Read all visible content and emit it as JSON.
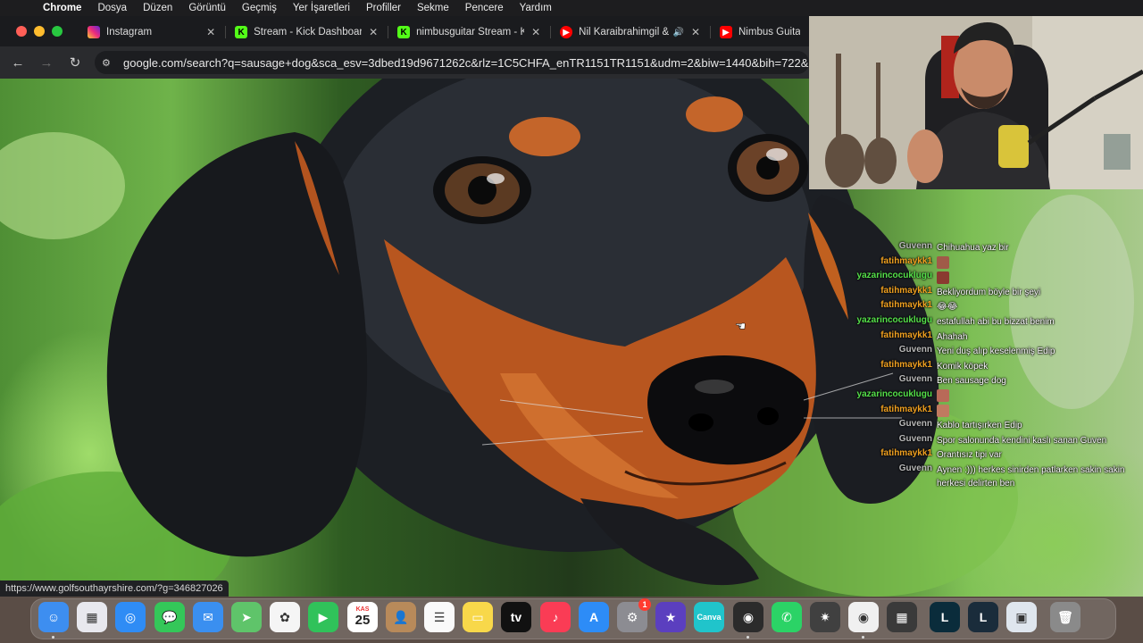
{
  "menubar": {
    "app": "Chrome",
    "items": [
      "Dosya",
      "Düzen",
      "Görüntü",
      "Geçmiş",
      "Yer İşaretleri",
      "Profiller",
      "Sekme",
      "Pencere",
      "Yardım"
    ]
  },
  "tabs": [
    {
      "title": "Instagram",
      "icon": "instagram-icon",
      "color": "#d6249f"
    },
    {
      "title": "Stream - Kick Dashboard",
      "icon": "kick-icon",
      "color": "#53fc18"
    },
    {
      "title": "nimbusguitar Stream - Kick",
      "icon": "kick-icon",
      "color": "#53fc18"
    },
    {
      "title": "Nil Karaibrahimgil &",
      "icon": "youtube-icon",
      "color": "#ff0000"
    },
    {
      "title": "Nimbus Guita",
      "icon": "youtube-icon",
      "color": "#ff0000"
    }
  ],
  "toolbar": {
    "url": "google.com/search?q=sausage+dog&sca_esv=3dbed19d9671262c&rlz=1C5CHFA_enTR1151TR1151&udm=2&biw=1440&bih=722&"
  },
  "status_url": "https://www.golfsouthayrshire.com/?g=346827026",
  "chat": [
    {
      "user": "Guvenn",
      "color": "#b9b9b9",
      "msg": "Chihuahua yaz bir"
    },
    {
      "user": "fatihmaykk1",
      "color": "#f0a020",
      "msg": "",
      "emote": "#a05a48"
    },
    {
      "user": "yazarincocuklugu",
      "color": "#55e04a",
      "msg": "",
      "emote": "#8a3a30"
    },
    {
      "user": "fatihmaykk1",
      "color": "#f0a020",
      "msg": "Bekliyordum böyle bir şeyi"
    },
    {
      "user": "fatihmaykk1",
      "color": "#f0a020",
      "msg": "😂😂"
    },
    {
      "user": "yazarincocuklugu",
      "color": "#55e04a",
      "msg": "estafullah abi bu bizzat benim"
    },
    {
      "user": "fatihmaykk1",
      "color": "#f0a020",
      "msg": "Ahahah"
    },
    {
      "user": "Guvenn",
      "color": "#b9b9b9",
      "msg": "Yeni duş alıp keselenmiş Edip"
    },
    {
      "user": "fatihmaykk1",
      "color": "#f0a020",
      "msg": "Komik köpek"
    },
    {
      "user": "Guvenn",
      "color": "#b9b9b9",
      "msg": "Ben sausage dog"
    },
    {
      "user": "yazarincocuklugu",
      "color": "#55e04a",
      "msg": "",
      "emote": "#b86a58"
    },
    {
      "user": "fatihmaykk1",
      "color": "#f0a020",
      "msg": "",
      "emote": "#c07a60"
    },
    {
      "user": "Guvenn",
      "color": "#b9b9b9",
      "msg": "Kablo tartışırken Edip"
    },
    {
      "user": "Guvenn",
      "color": "#b9b9b9",
      "msg": "Spor salonunda kendini kaslı sanan Guven"
    },
    {
      "user": "fatihmaykk1",
      "color": "#f0a020",
      "msg": "Orantısız tipi var"
    },
    {
      "user": "Guvenn",
      "color": "#b9b9b9",
      "msg": "Aynen :))) herkes sinirden patlarken sakin sakin herkesi delirten ben"
    }
  ],
  "dock": [
    {
      "name": "finder-icon",
      "bg": "#3d8ef0",
      "label": "☺",
      "dot": true
    },
    {
      "name": "launchpad-icon",
      "bg": "#e8e8ee",
      "label": "▦"
    },
    {
      "name": "safari-icon",
      "bg": "#2f8cf5",
      "label": "◎"
    },
    {
      "name": "messages-icon",
      "bg": "#34c759",
      "label": "💬"
    },
    {
      "name": "mail-icon",
      "bg": "#3a8ff0",
      "label": "✉"
    },
    {
      "name": "maps-icon",
      "bg": "#5fc46a",
      "label": "➤"
    },
    {
      "name": "photos-icon",
      "bg": "#f5f5f5",
      "label": "✿"
    },
    {
      "name": "facetime-icon",
      "bg": "#30c25a",
      "label": "▶"
    },
    {
      "name": "calendar-icon",
      "bg": "#ffffff",
      "label": "25",
      "month": "KAS"
    },
    {
      "name": "contacts-icon",
      "bg": "#b88a5a",
      "label": "👤"
    },
    {
      "name": "reminders-icon",
      "bg": "#fafafa",
      "label": "☰"
    },
    {
      "name": "notes-icon",
      "bg": "#f8d84a",
      "label": "▭"
    },
    {
      "name": "apple-tv-icon",
      "bg": "#111111",
      "label": "tv"
    },
    {
      "name": "music-icon",
      "bg": "#fa3c55",
      "label": "♪"
    },
    {
      "name": "app-store-icon",
      "bg": "#2d8cf7",
      "label": "A"
    },
    {
      "name": "system-settings-icon",
      "bg": "#8c8c92",
      "label": "⚙",
      "badge": "1"
    },
    {
      "name": "imovie-icon",
      "bg": "#5b3fbf",
      "label": "★"
    },
    {
      "name": "canva-icon",
      "bg": "#20c4cb",
      "label": "Canva"
    },
    {
      "name": "obs-icon",
      "bg": "#2b2b2b",
      "label": "◉",
      "dot": true
    },
    {
      "name": "whatsapp-icon",
      "bg": "#2bd366",
      "label": "✆"
    },
    {
      "name": "compressor-icon",
      "bg": "#404040",
      "label": "✷"
    },
    {
      "name": "chrome-icon",
      "bg": "#f0f0f0",
      "label": "◉",
      "dot": true
    },
    {
      "name": "calculator-icon",
      "bg": "#3a3a3a",
      "label": "▦"
    },
    {
      "name": "league-of-legends-icon",
      "bg": "#0a2c3b",
      "label": "L"
    },
    {
      "name": "league-client-icon",
      "bg": "#1a2c3b",
      "label": "L"
    },
    {
      "name": "preview-icon",
      "bg": "#dfe6ee",
      "label": "▣"
    },
    {
      "name": "trash-icon",
      "bg": "#8a8a8a",
      "label": "🗑"
    }
  ]
}
